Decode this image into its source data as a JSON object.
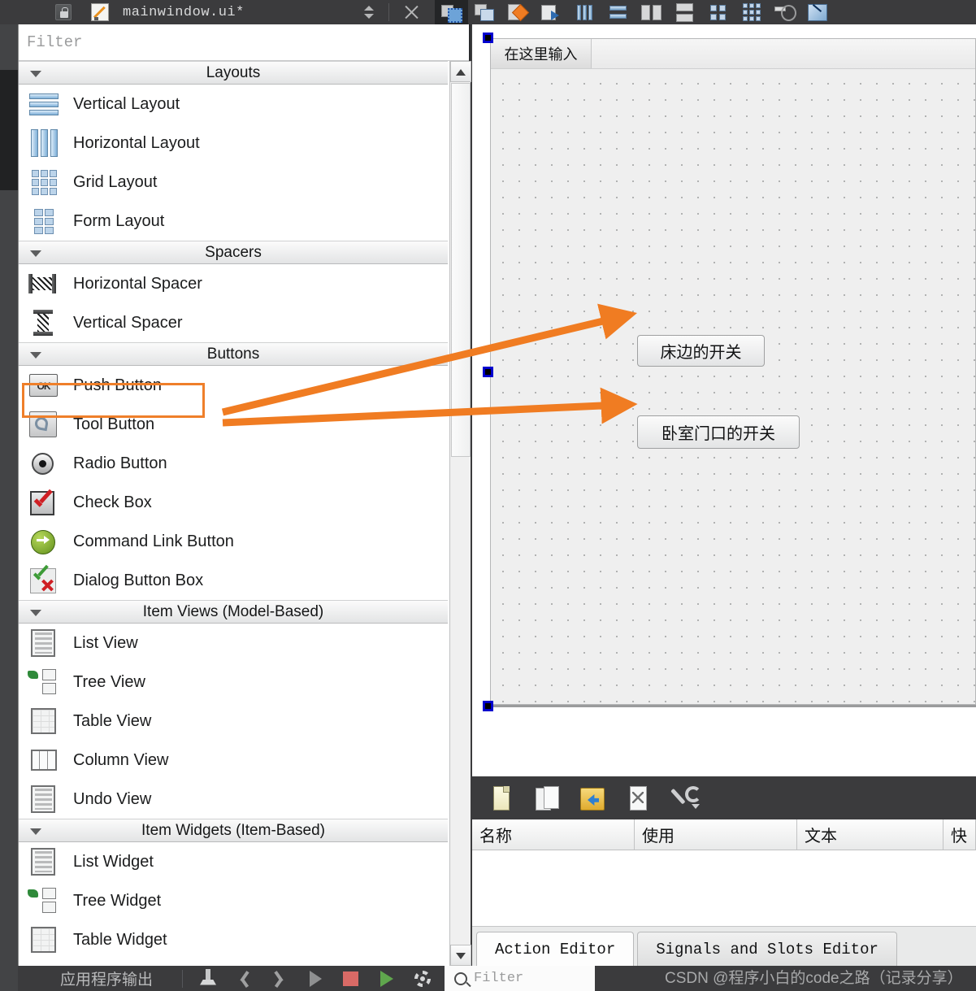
{
  "window": {
    "dock_title": "mainwindow.ui*",
    "pencil_icon": "pencil-icon",
    "lock_icon": "lock-icon",
    "float_icon": "float-dock-icon",
    "close_icon": "close-icon"
  },
  "toolbar": {
    "items": [
      {
        "name": "edit-widgets",
        "icon": "widget-edit-icon",
        "active": true
      },
      {
        "name": "edit-signals-slots",
        "icon": "signals-slots-icon",
        "active": false
      },
      {
        "name": "edit-buddies",
        "icon": "buddy-edit-icon",
        "active": false
      },
      {
        "name": "edit-tab-order",
        "icon": "tab-order-icon",
        "active": false
      },
      {
        "name": "layout-horizontally",
        "icon": "horizontal-layout-icon",
        "active": false
      },
      {
        "name": "layout-vertically",
        "icon": "vertical-layout-icon",
        "active": false
      },
      {
        "name": "layout-splitter-horizontal",
        "icon": "splitter-horizontal-icon",
        "active": false
      },
      {
        "name": "layout-splitter-vertical",
        "icon": "splitter-vertical-icon",
        "active": false
      },
      {
        "name": "layout-form",
        "icon": "form-layout-icon",
        "active": false
      },
      {
        "name": "layout-grid",
        "icon": "grid-layout-icon",
        "active": false
      },
      {
        "name": "break-layout",
        "icon": "break-layout-icon",
        "active": false
      },
      {
        "name": "adjust-size",
        "icon": "adjust-size-icon",
        "active": false
      }
    ]
  },
  "widget_box": {
    "filter_placeholder": "Filter",
    "groups": [
      {
        "title": "Layouts",
        "items": [
          {
            "label": "Vertical Layout",
            "icon": "vertical-layout-icon"
          },
          {
            "label": "Horizontal Layout",
            "icon": "horizontal-layout-icon"
          },
          {
            "label": "Grid Layout",
            "icon": "grid-layout-icon"
          },
          {
            "label": "Form Layout",
            "icon": "form-layout-icon"
          }
        ]
      },
      {
        "title": "Spacers",
        "items": [
          {
            "label": "Horizontal Spacer",
            "icon": "horizontal-spacer-icon"
          },
          {
            "label": "Vertical Spacer",
            "icon": "vertical-spacer-icon"
          }
        ]
      },
      {
        "title": "Buttons",
        "items": [
          {
            "label": "Push Button",
            "icon": "push-button-icon",
            "icon_text": "OK",
            "highlighted": true
          },
          {
            "label": "Tool Button",
            "icon": "tool-button-icon"
          },
          {
            "label": "Radio Button",
            "icon": "radio-button-icon"
          },
          {
            "label": "Check Box",
            "icon": "check-box-icon"
          },
          {
            "label": "Command Link Button",
            "icon": "command-link-icon"
          },
          {
            "label": "Dialog Button Box",
            "icon": "dialog-button-box-icon"
          }
        ]
      },
      {
        "title": "Item Views (Model-Based)",
        "items": [
          {
            "label": "List View",
            "icon": "list-view-icon"
          },
          {
            "label": "Tree View",
            "icon": "tree-view-icon"
          },
          {
            "label": "Table View",
            "icon": "table-view-icon"
          },
          {
            "label": "Column View",
            "icon": "column-view-icon"
          },
          {
            "label": "Undo View",
            "icon": "undo-view-icon"
          }
        ]
      },
      {
        "title": "Item Widgets (Item-Based)",
        "items": [
          {
            "label": "List Widget",
            "icon": "list-widget-icon"
          },
          {
            "label": "Tree Widget",
            "icon": "tree-widget-icon"
          },
          {
            "label": "Table Widget",
            "icon": "table-widget-icon"
          }
        ]
      }
    ],
    "scrollbar": {
      "up_icon": "scroll-up-arrow-icon",
      "down_icon": "scroll-down-arrow-icon"
    }
  },
  "form": {
    "menubar_placeholder": "在这里输入",
    "buttons": [
      {
        "text": "床边的开关"
      },
      {
        "text": "卧室门口的开关"
      }
    ],
    "selection_handles": 3
  },
  "action_editor": {
    "toolbar": [
      {
        "name": "new-action",
        "icon": "new-action-icon"
      },
      {
        "name": "copy-action",
        "icon": "copy-action-icon"
      },
      {
        "name": "paste-action",
        "icon": "paste-action-icon"
      },
      {
        "name": "delete-action",
        "icon": "delete-action-icon"
      },
      {
        "name": "configure-action",
        "icon": "wrench-icon"
      }
    ],
    "columns": [
      "名称",
      "使用",
      "文本",
      "快"
    ],
    "rows": [],
    "tabs": [
      {
        "label": "Action Editor",
        "selected": true
      },
      {
        "label": "Signals and Slots Editor",
        "selected": false
      }
    ]
  },
  "statusbar": {
    "label": "应用程序输出",
    "icons": [
      {
        "name": "build-icon"
      },
      {
        "name": "previous-item-icon"
      },
      {
        "name": "next-item-icon"
      },
      {
        "name": "run-disabled-icon"
      },
      {
        "name": "stop-icon"
      },
      {
        "name": "run-icon"
      },
      {
        "name": "settings-gear-icon"
      }
    ],
    "filter_placeholder": "Filter",
    "search_icon": "search-icon"
  },
  "annotations": {
    "arrow_color": "#f07c22",
    "highlight_color": "#ef7f2a",
    "arrows": [
      {
        "name": "arrow-push-button-to-top-button"
      },
      {
        "name": "arrow-push-button-to-bottom-button"
      }
    ]
  },
  "watermark": {
    "text": "CSDN @程序小白的code之路（记录分享）"
  }
}
